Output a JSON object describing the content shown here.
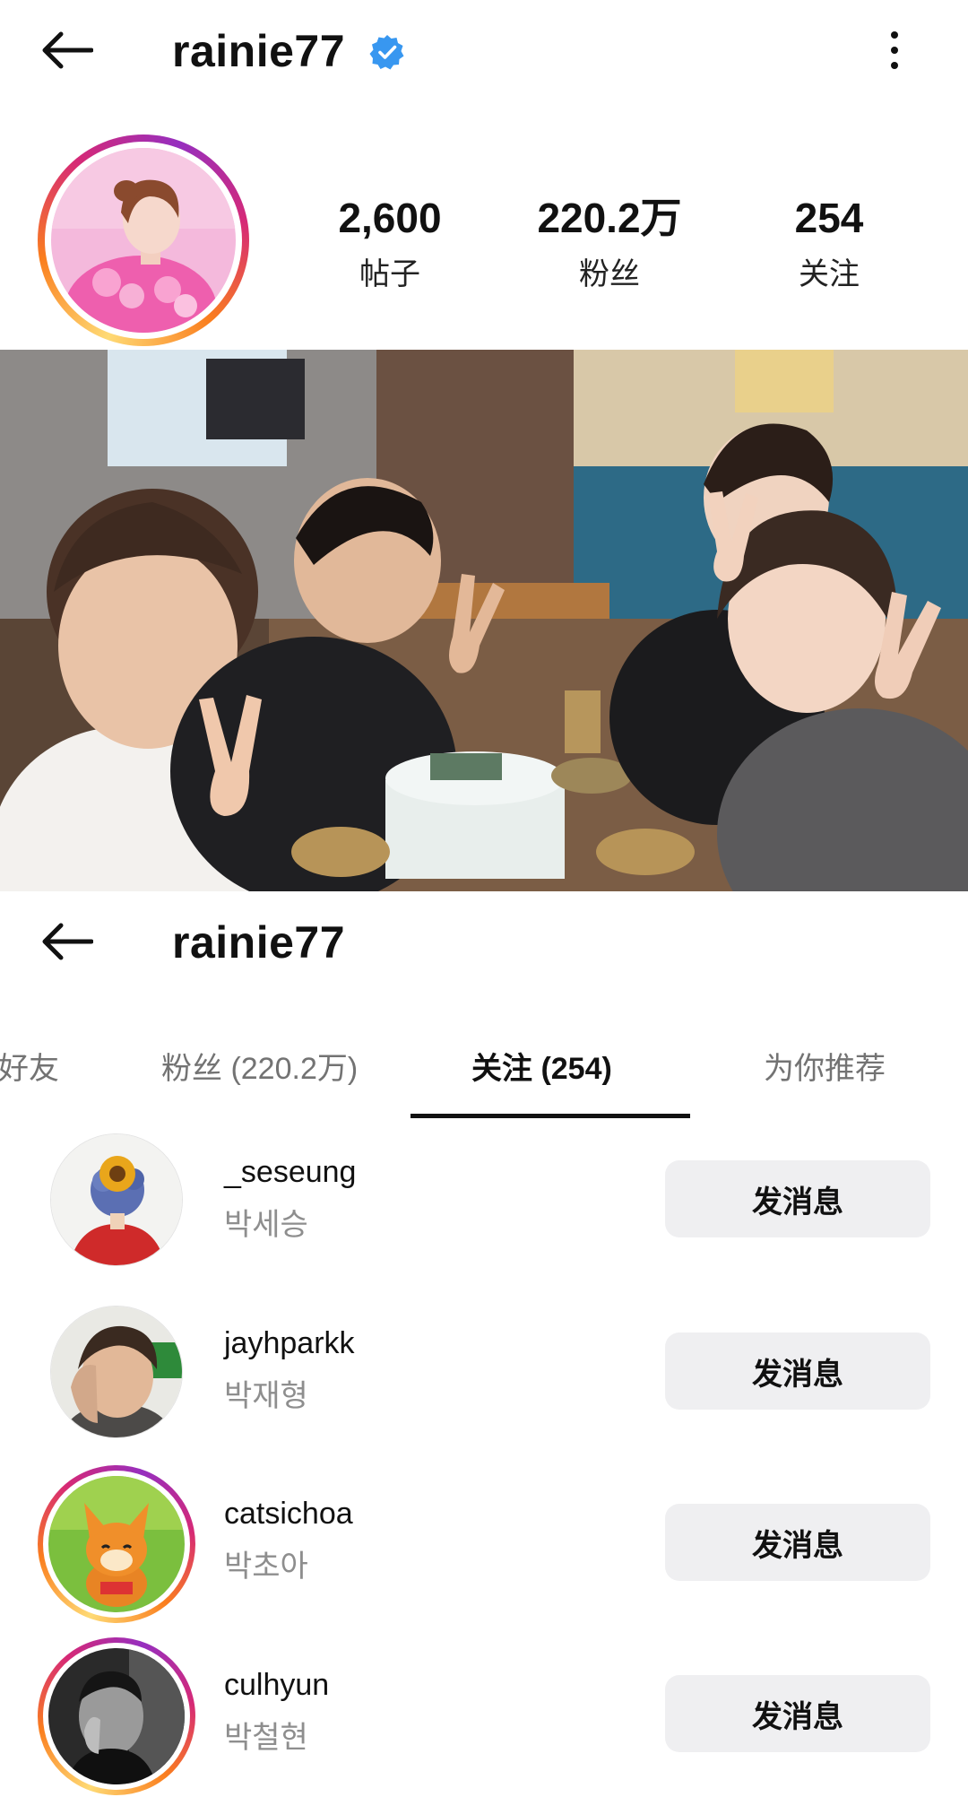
{
  "header": {
    "username": "rainie77"
  },
  "stats": {
    "posts_value": "2,600",
    "posts_label": "帖子",
    "followers_value": "220.2万",
    "followers_label": "粉丝",
    "following_value": "254",
    "following_label": "关注"
  },
  "second_header": {
    "username": "rainie77"
  },
  "tabs": [
    {
      "label": "同好友"
    },
    {
      "label": "粉丝 (220.2万)"
    },
    {
      "label": "关注 (254)"
    },
    {
      "label": "为你推荐"
    }
  ],
  "following_list": [
    {
      "username": "_seseung",
      "full_name": "박세승",
      "button": "发消息"
    },
    {
      "username": "jayhparkk",
      "full_name": "박재형",
      "button": "发消息"
    },
    {
      "username": "catsichoa",
      "full_name": "박초아",
      "button": "发消息"
    },
    {
      "username": "culhyun",
      "full_name": "박철현",
      "button": "发消息"
    }
  ],
  "colors": {
    "verified_badge": "#3897f0",
    "message_button_bg": "#efeff1",
    "secondary_text": "#8e8e8e",
    "tab_inactive": "#737373"
  }
}
